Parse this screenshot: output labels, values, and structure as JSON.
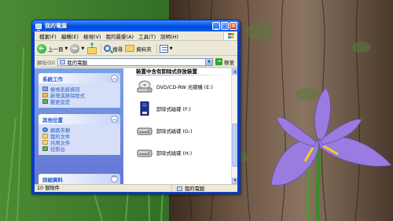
{
  "window": {
    "title": "我的電腦"
  },
  "menubar": {
    "items": [
      "檔案(F)",
      "編輯(E)",
      "檢視(V)",
      "我的最愛(A)",
      "工具(T)",
      "說明(H)"
    ]
  },
  "toolbar": {
    "back_label": "上一頁",
    "search_label": "搜尋",
    "folders_label": "資料夾"
  },
  "addressbar": {
    "label": "網址(D)",
    "value": "我的電腦",
    "go_label": "移至"
  },
  "taskpane": {
    "system_tasks": {
      "title": "系統工作",
      "items": [
        "檢視系統資訊",
        "新增或移除程式",
        "變更設定"
      ]
    },
    "other_places": {
      "title": "其他位置",
      "items": [
        "網路芳鄰",
        "我的文件",
        "共用文件",
        "控制台"
      ]
    },
    "details": {
      "title": "詳細資料"
    }
  },
  "content": {
    "section_title": "裝置中含有卸除式存放裝置",
    "drives": [
      {
        "label": "DVD/CD-RW 光碟機 (E:)",
        "icon": "optical-drive-icon"
      },
      {
        "label": "卸除式磁碟 (F:)",
        "icon": "removable-card-icon"
      },
      {
        "label": "卸除式磁碟 (G:)",
        "icon": "removable-drive-icon"
      },
      {
        "label": "卸除式磁碟 (H:)",
        "icon": "removable-drive-icon"
      }
    ]
  },
  "statusbar": {
    "left": "10 個物件",
    "right": "我的電腦"
  }
}
